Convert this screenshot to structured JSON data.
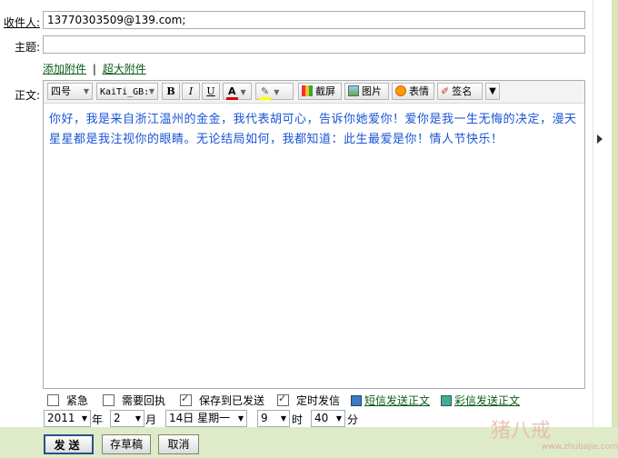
{
  "compose": {
    "to_label": "收件人:",
    "to_value": "13770303509@139.com;",
    "subject_label": "主题:",
    "subject_value": "",
    "attach_link": "添加附件",
    "separator": "|",
    "big_attach_link": "超大附件",
    "body_label": "正文:"
  },
  "toolbar": {
    "font_size": "四号",
    "font_family": "KaiTi_GB:",
    "bold": "B",
    "italic": "I",
    "underline": "U",
    "font_color": "A",
    "screenshot": "截屏",
    "image": "图片",
    "emoji": "表情",
    "signature": "签名",
    "more": "▼"
  },
  "body_text": "你好，我是来自浙江温州的金金，我代表胡可心，告诉你她爱你！爱你是我一生无悔的决定，漫天星星都是我注视你的眼睛。无论结局如何，我都知道：此生最爱是你！情人节快乐！",
  "options": {
    "urgent": {
      "label": "紧急",
      "checked": false
    },
    "receipt": {
      "label": "需要回执",
      "checked": false
    },
    "save_sent": {
      "label": "保存到已发送",
      "checked": true
    },
    "scheduled": {
      "label": "定时发信",
      "checked": true
    },
    "sms_link": "短信发送正文",
    "mms_link": "彩信发送正文"
  },
  "schedule": {
    "year": "2011",
    "year_unit": "年",
    "month": "2",
    "month_unit": "月",
    "day": "14日 星期一",
    "hour": "9",
    "hour_unit": "时",
    "minute": "40",
    "minute_unit": "分"
  },
  "buttons": {
    "send": "发送",
    "draft": "存草稿",
    "cancel": "取消"
  },
  "watermark": {
    "logo": "猪八戒",
    "url": "www.zhubajie.com"
  },
  "colors": {
    "body_text": "#1a54d6",
    "link": "#0b5b1a",
    "footer": "#dfeac8"
  }
}
